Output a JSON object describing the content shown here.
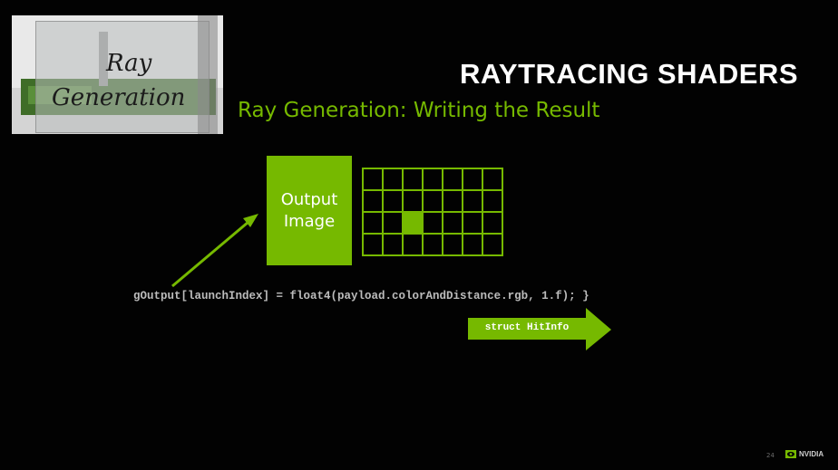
{
  "slide": {
    "title": "RAYTRACING SHADERS",
    "subtitle": "Ray Generation: Writing the Result",
    "thumbnail": {
      "line1": "Ray",
      "line2": "Generation"
    },
    "output_box": {
      "line1": "Output",
      "line2": "Image"
    },
    "grid": {
      "cols": 7,
      "rows": 4,
      "highlight_col": 2,
      "highlight_row": 2
    },
    "code_line": "gOutput[launchIndex] = float4(payload.colorAndDistance.rgb, 1.f); }",
    "struct_arrow_label": "struct HitInfo",
    "page_number": "24",
    "logo_text": "NVIDIA"
  },
  "colors": {
    "accent": "#76b900",
    "background": "#020202",
    "title": "#ffffff",
    "code": "#bcbcbc"
  }
}
